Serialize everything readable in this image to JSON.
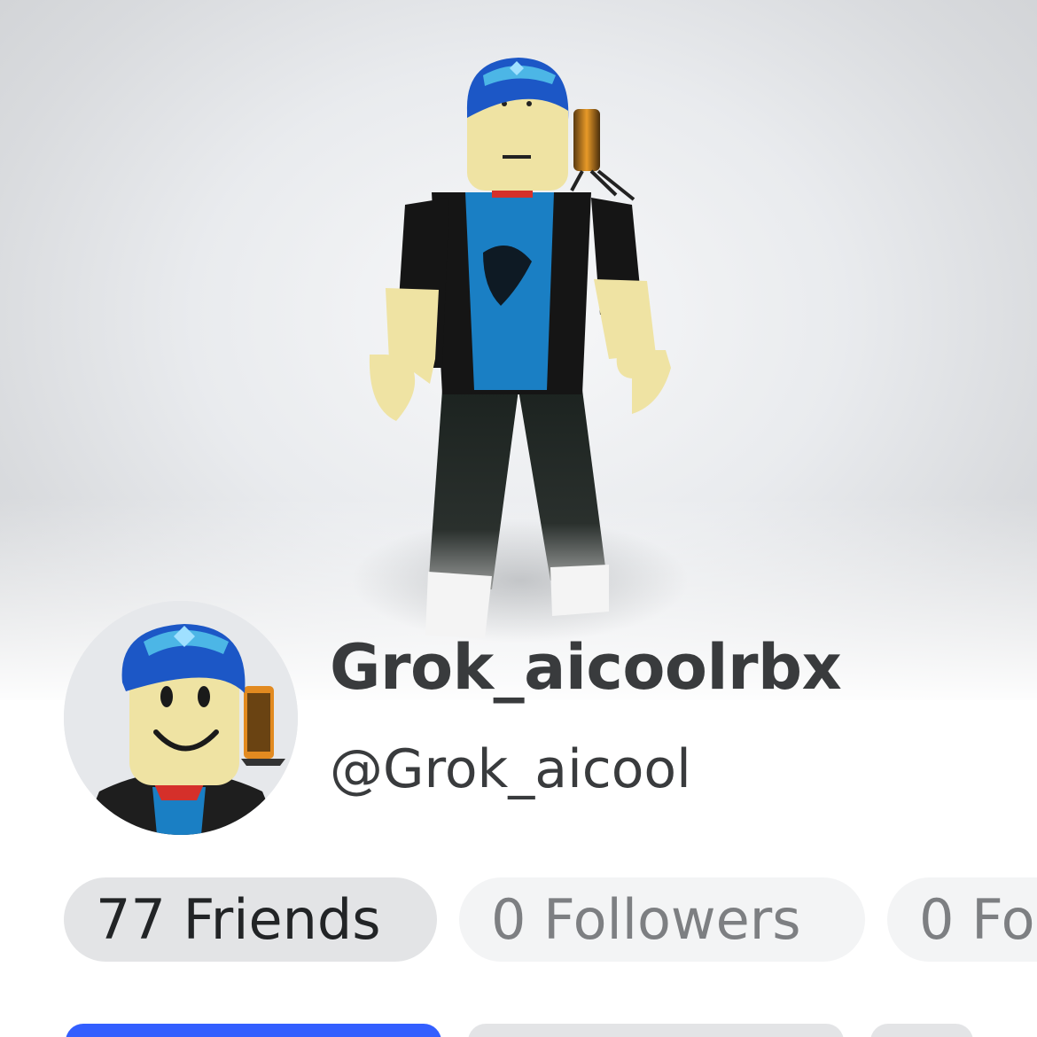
{
  "profile": {
    "display_name": "Grok_aicoolrbx",
    "username": "@Grok_aicool"
  },
  "stats": {
    "friends_label": "77 Friends",
    "followers_label": "0 Followers",
    "following_label": "0 Fo"
  },
  "colors": {
    "primary_button": "#335fff",
    "pill_active": "#e3e4e6",
    "pill_inactive": "#f3f4f5",
    "name_text": "#393b3d"
  },
  "icons": {
    "avatar": "roblox-avatar-full-body",
    "headshot": "roblox-avatar-headshot"
  }
}
